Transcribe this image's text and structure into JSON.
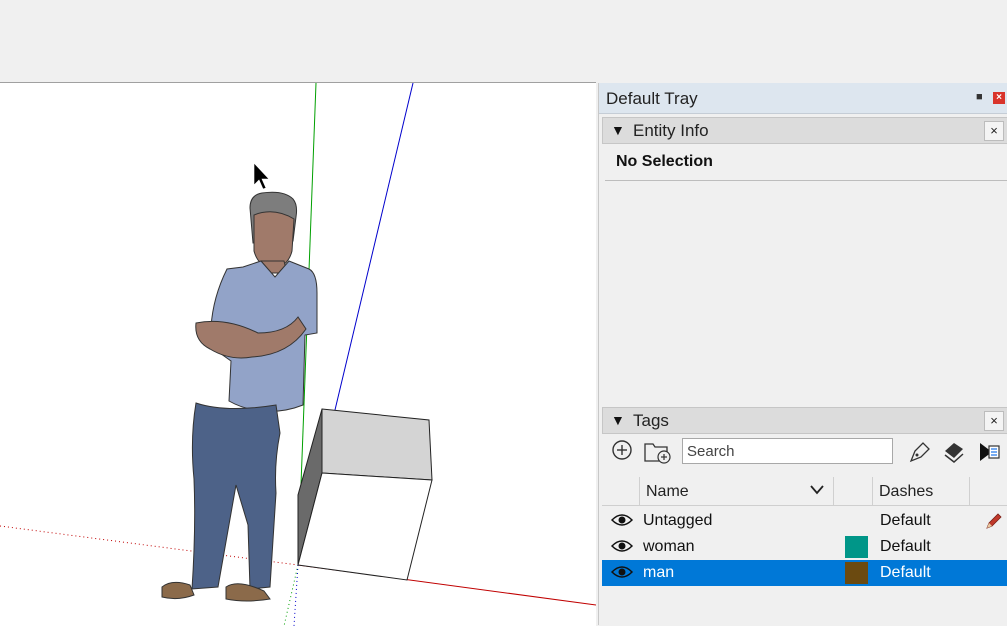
{
  "tray": {
    "title": "Default Tray",
    "pin_glyph": "■",
    "close_glyph": "×"
  },
  "entity_info": {
    "title": "Entity Info",
    "status": "No Selection"
  },
  "tags": {
    "title": "Tags",
    "search_placeholder": "Search",
    "columns": {
      "name": "Name",
      "dashes": "Dashes"
    },
    "rows": [
      {
        "name": "Untagged",
        "color": "",
        "dashes": "Default",
        "selected": false,
        "icon": "pencil-icon"
      },
      {
        "name": "woman",
        "color": "#009688",
        "dashes": "Default",
        "selected": false
      },
      {
        "name": "man",
        "color": "#6b4a10",
        "dashes": "Default",
        "selected": true
      }
    ]
  },
  "colors": {
    "selection": "#0078d7",
    "x_axis": "#c00000",
    "y_axis": "#00a000",
    "z_axis": "#0000cc"
  }
}
